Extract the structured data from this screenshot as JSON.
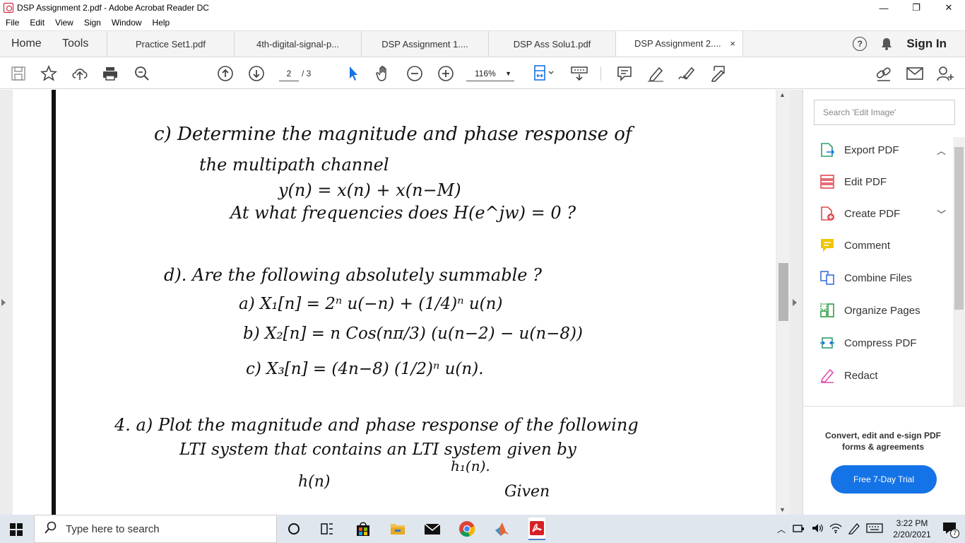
{
  "window": {
    "title": "DSP Assignment 2.pdf - Adobe Acrobat Reader DC"
  },
  "menu": [
    "File",
    "Edit",
    "View",
    "Sign",
    "Window",
    "Help"
  ],
  "tabs": {
    "home": "Home",
    "tools": "Tools",
    "docs": [
      "Practice Set1.pdf",
      "4th-digital-signal-p...",
      "DSP Assignment 1....",
      "DSP Ass Solu1.pdf",
      "DSP Assignment 2...."
    ],
    "close_glyph": "×",
    "sign_in": "Sign In"
  },
  "toolbar": {
    "page_current": "2",
    "page_total": "/ 3",
    "zoom": "116%"
  },
  "document": {
    "lines": [
      "c)  Determine the magnitude and phase response of",
      "the multipath channel",
      "y(n) =  x(n) + x(n−M)",
      "At  what frequencies does  H(e^jw) = 0 ?",
      "d).  Are the following absolutely summable ?",
      "a) X₁[n] =  2ⁿ u(−n) + (1/4)ⁿ u(n)",
      "b) X₂[n] = n Cos(nπ/3) (u(n−2) − u(n−8))",
      "c) X₃[n] =  (4n−8) (1/2)ⁿ u(n).",
      "4.  a) Plot the magnitude and phase response of the following",
      "LTI system that contains an LTI system given by",
      "h₁(n).",
      "h(n)",
      "Given"
    ]
  },
  "right_panel": {
    "search_placeholder": "Search 'Edit Image'",
    "tools": [
      {
        "label": "Export PDF",
        "icon": "export-pdf-icon",
        "color": "#2d9d78"
      },
      {
        "label": "Edit PDF",
        "icon": "edit-pdf-icon",
        "color": "#e34850"
      },
      {
        "label": "Create PDF",
        "icon": "create-pdf-icon",
        "color": "#e34850"
      },
      {
        "label": "Comment",
        "icon": "comment-icon",
        "color": "#f0c600"
      },
      {
        "label": "Combine Files",
        "icon": "combine-files-icon",
        "color": "#3a6fd8"
      },
      {
        "label": "Organize Pages",
        "icon": "organize-pages-icon",
        "color": "#2ea043"
      },
      {
        "label": "Compress PDF",
        "icon": "compress-pdf-icon",
        "color": "#2d9d78"
      },
      {
        "label": "Redact",
        "icon": "redact-icon",
        "color": "#e04dae"
      }
    ],
    "promo_text": "Convert, edit and e-sign PDF forms & agreements",
    "trial_button": "Free 7-Day Trial"
  },
  "taskbar": {
    "search_placeholder": "Type here to search",
    "time": "3:22 PM",
    "date": "2/20/2021",
    "notification_count": "7"
  }
}
